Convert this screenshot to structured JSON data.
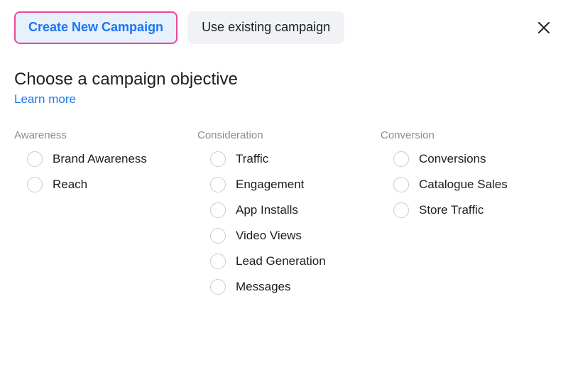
{
  "header": {
    "tabs": {
      "create": "Create New Campaign",
      "existing": "Use existing campaign"
    }
  },
  "section": {
    "title": "Choose a campaign objective",
    "learn_more": "Learn more"
  },
  "columns": {
    "awareness": {
      "header": "Awareness",
      "options": {
        "brand_awareness": "Brand Awareness",
        "reach": "Reach"
      }
    },
    "consideration": {
      "header": "Consideration",
      "options": {
        "traffic": "Traffic",
        "engagement": "Engagement",
        "app_installs": "App Installs",
        "video_views": "Video Views",
        "lead_generation": "Lead Generation",
        "messages": "Messages"
      }
    },
    "conversion": {
      "header": "Conversion",
      "options": {
        "conversions": "Conversions",
        "catalogue_sales": "Catalogue Sales",
        "store_traffic": "Store Traffic"
      }
    }
  }
}
